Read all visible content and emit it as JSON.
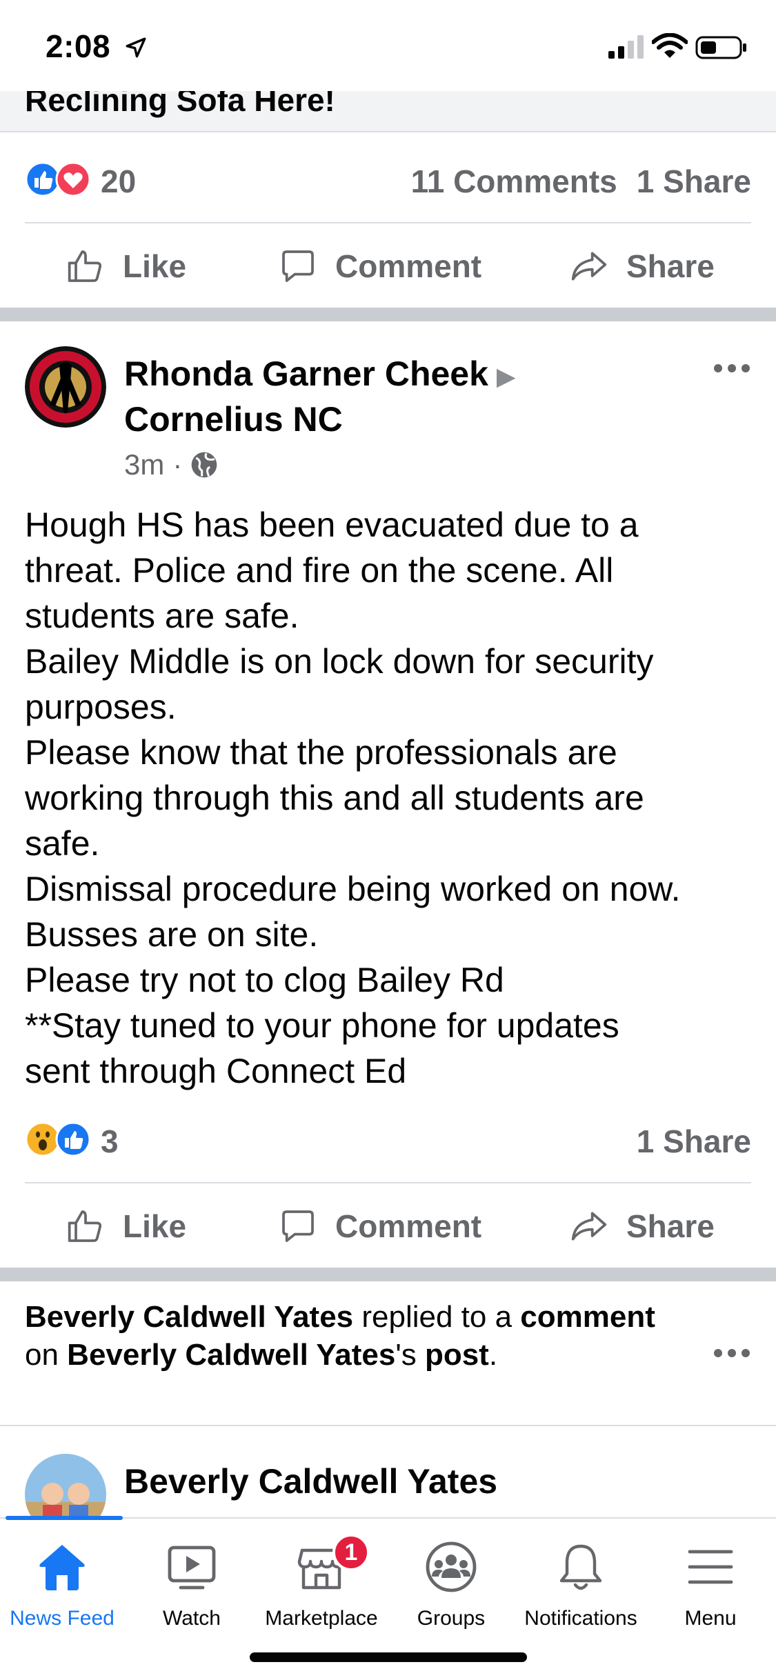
{
  "status_bar": {
    "time": "2:08"
  },
  "prev_post": {
    "banner_text": "Reclining Sofa Here!",
    "reaction_count": "20",
    "comments": "11 Comments",
    "shares": "1 Share"
  },
  "actions": {
    "like": "Like",
    "comment": "Comment",
    "share": "Share"
  },
  "post": {
    "author": "Rhonda Garner Cheek",
    "group": "Cornelius NC",
    "time": "3m",
    "separator": "·",
    "text": "Hough HS has been evacuated due to a\nthreat. Police and fire on the scene. All\nstudents are safe.\nBailey Middle is on lock down for security\npurposes.\nPlease know that the professionals are\nworking through this and all students are\nsafe.\nDismissal procedure being worked on now.\nBusses are on site.\nPlease try not to clog Bailey Rd\n**Stay tuned to your phone for updates\nsent through Connect Ed",
    "reaction_count": "3",
    "shares": "1 Share"
  },
  "notification": {
    "actor": "Beverly Caldwell Yates",
    "verb": " replied to a ",
    "object": "comment",
    "prep": " on ",
    "owner": "Beverly Caldwell Yates",
    "suffix": "'s",
    "end_word": "post",
    "period": "."
  },
  "next_post": {
    "author": "Beverly Caldwell Yates"
  },
  "bottom_nav": {
    "items": [
      {
        "label": "News Feed",
        "icon": "home-icon",
        "active": true
      },
      {
        "label": "Watch",
        "icon": "watch-icon"
      },
      {
        "label": "Marketplace",
        "icon": "marketplace-icon",
        "badge": "1"
      },
      {
        "label": "Groups",
        "icon": "groups-icon"
      },
      {
        "label": "Notifications",
        "icon": "bell-icon"
      },
      {
        "label": "Menu",
        "icon": "menu-icon"
      }
    ]
  },
  "colors": {
    "accent": "#1877f2",
    "muted": "#65676b",
    "love": "#f33e58",
    "badge": "#e41e3f",
    "separator": "#c9ccd1"
  }
}
